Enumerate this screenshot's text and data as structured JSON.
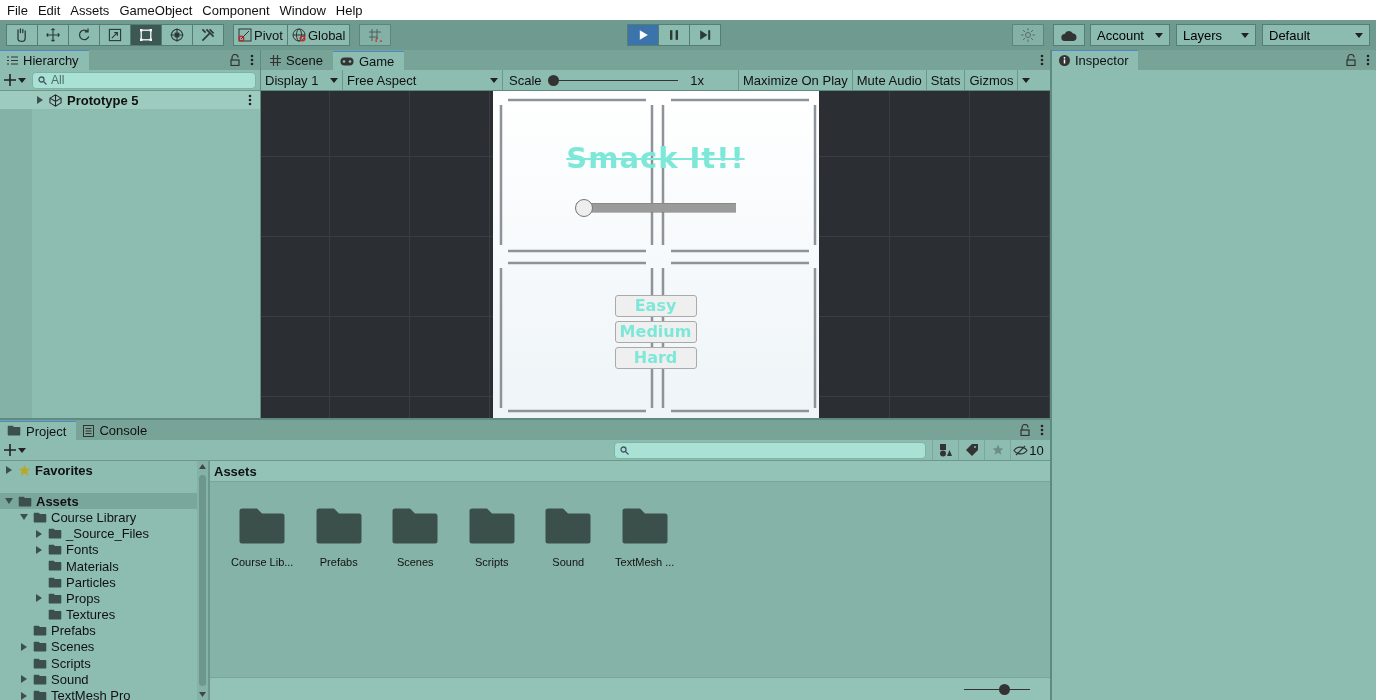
{
  "menu": [
    "File",
    "Edit",
    "Assets",
    "GameObject",
    "Component",
    "Window",
    "Help"
  ],
  "toolbar": {
    "tools": [
      {
        "kind": "hand",
        "selected": false
      },
      {
        "kind": "move",
        "selected": false
      },
      {
        "kind": "rotate",
        "selected": false
      },
      {
        "kind": "scale",
        "selected": false
      },
      {
        "kind": "rect",
        "selected": true
      },
      {
        "kind": "transform",
        "selected": false
      },
      {
        "kind": "custom",
        "selected": false
      }
    ],
    "pivot": "Pivot",
    "global": "Global",
    "playback": [
      {
        "kind": "play",
        "selected": true
      },
      {
        "kind": "pause",
        "selected": false
      },
      {
        "kind": "step",
        "selected": false
      }
    ],
    "dropdowns": [
      "Account",
      "Layers",
      "Default"
    ]
  },
  "hierarchy": {
    "tab": "Hierarchy",
    "search": {
      "placeholder": "All"
    },
    "items": [
      {
        "label": "Prototype 5",
        "expanded": false
      }
    ]
  },
  "game_panel": {
    "tabs": [
      {
        "label": "Scene",
        "kind": "scene",
        "selected": false
      },
      {
        "label": "Game",
        "kind": "game",
        "selected": true
      }
    ],
    "display": "Display 1",
    "aspect": "Free Aspect",
    "scale_label": "Scale",
    "scale": {
      "level": 0
    },
    "scale_value": "1x",
    "toggles": [
      "Maximize On Play",
      "Mute Audio",
      "Stats",
      "Gizmos"
    ],
    "game": {
      "title": "Smack It!!",
      "slider": {
        "level": 0
      },
      "buttons": [
        "Easy",
        "Medium",
        "Hard"
      ]
    }
  },
  "inspector": {
    "tab": "Inspector"
  },
  "project": {
    "tabs": [
      {
        "label": "Project",
        "kind": "project",
        "selected": true
      },
      {
        "label": "Console",
        "kind": "console",
        "selected": false
      }
    ],
    "hidden_count": "10",
    "tree": [
      {
        "label": "Favorites",
        "kind": "favorites",
        "expanded": false,
        "selected": false
      },
      {
        "label": "Assets",
        "kind": "folder",
        "expanded": true,
        "selected": true,
        "children": [
          {
            "label": "Course Library",
            "kind": "folder",
            "expanded": true,
            "selected": false,
            "children": [
              {
                "label": "_Source_Files",
                "kind": "folder",
                "expanded": false,
                "selected": false
              },
              {
                "label": "Fonts",
                "kind": "folder",
                "expanded": false,
                "selected": false
              },
              {
                "label": "Materials",
                "kind": "folder",
                "selected": false
              },
              {
                "label": "Particles",
                "kind": "folder",
                "selected": false
              },
              {
                "label": "Props",
                "kind": "folder",
                "expanded": false,
                "selected": false
              },
              {
                "label": "Textures",
                "kind": "folder",
                "selected": false
              }
            ]
          },
          {
            "label": "Prefabs",
            "kind": "folder",
            "selected": false
          },
          {
            "label": "Scenes",
            "kind": "folder",
            "expanded": false,
            "selected": false
          },
          {
            "label": "Scripts",
            "kind": "folder",
            "selected": false
          },
          {
            "label": "Sound",
            "kind": "folder",
            "expanded": false,
            "selected": false
          },
          {
            "label": "TextMesh Pro",
            "kind": "folder",
            "expanded": false,
            "selected": false
          }
        ]
      }
    ],
    "breadcrumb": "Assets",
    "assets": [
      "Course Lib...",
      "Prefabs",
      "Scenes",
      "Scripts",
      "Sound",
      "TextMesh ..."
    ],
    "zoom": {
      "level": 0.6
    }
  }
}
